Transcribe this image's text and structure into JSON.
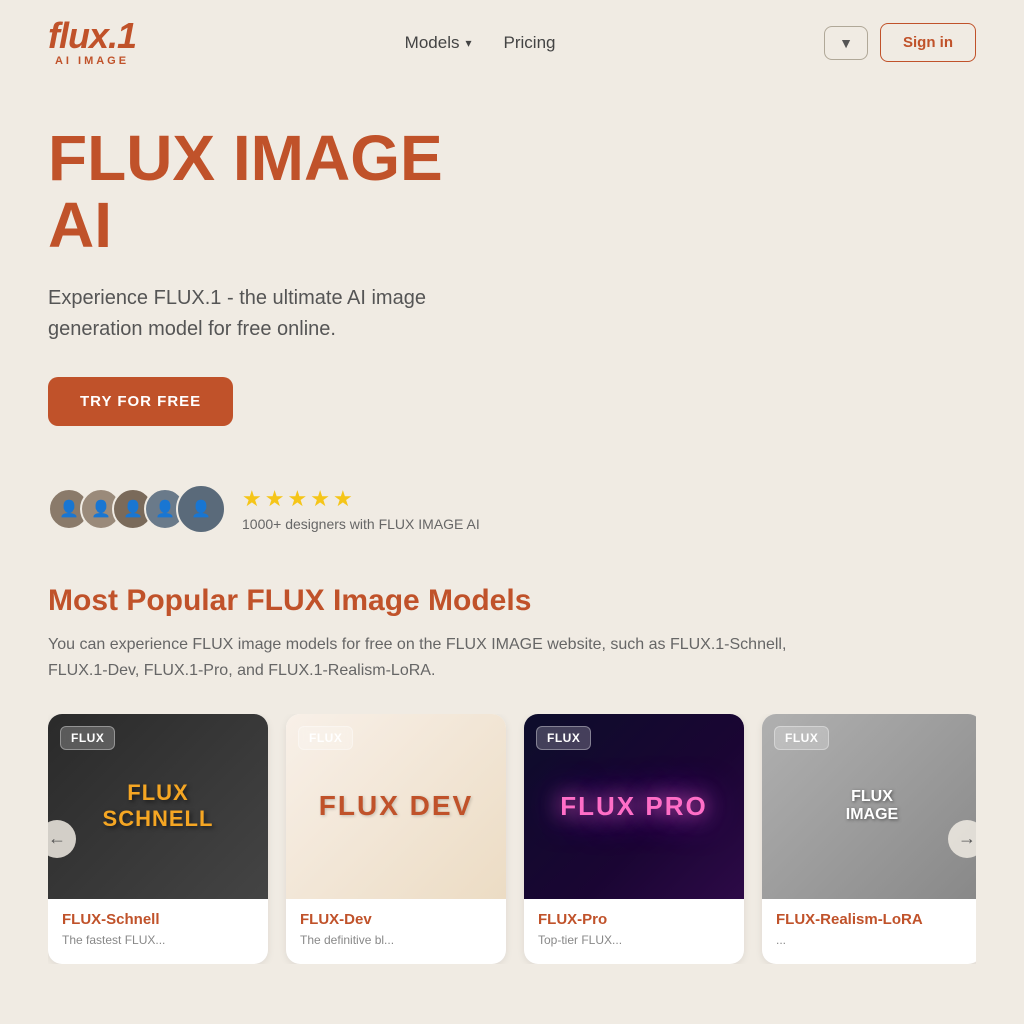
{
  "header": {
    "logo_main": "flux.1",
    "logo_sub": "AI IMAGE",
    "nav_models": "Models",
    "nav_pricing": "Pricing",
    "lang_btn_icon": "▼",
    "sign_in_label": "Sign in"
  },
  "hero": {
    "title_line1": "FLUX IMAGE",
    "title_line2": "AI",
    "description": "Experience FLUX.1 - the ultimate AI image generation model for free online.",
    "cta_label": "TRY FOR FREE"
  },
  "social_proof": {
    "stars": [
      "★",
      "★",
      "★",
      "★",
      "★"
    ],
    "text": "1000+ designers with FLUX IMAGE AI"
  },
  "models_section": {
    "title": "Most Popular FLUX Image Models",
    "description": "You can experience FLUX image models for free on the FLUX IMAGE website, such as FLUX.1-Schnell, FLUX.1-Dev, FLUX.1-Pro, and FLUX.1-Realism-LoRA.",
    "prev_label": "←",
    "next_label": "→"
  },
  "cards": [
    {
      "badge": "FLUX",
      "img_label_1": "FLUX",
      "img_label_2": "SCHNELL",
      "title": "FLUX-Schnell",
      "subtitle": "The fastest FLUX...",
      "style": "schnell"
    },
    {
      "badge": "FLUX",
      "img_label_1": "FLUX",
      "img_label_2": "DEV",
      "title": "FLUX-Dev",
      "subtitle": "The definitive bl...",
      "style": "dev"
    },
    {
      "badge": "FLUX",
      "img_label_1": "FLUX",
      "img_label_2": "PRO",
      "title": "FLUX-Pro",
      "subtitle": "Top-tier FLUX...",
      "style": "pro"
    },
    {
      "badge": "FLUX",
      "img_label_1": "FLUX",
      "img_label_2": "IMAGE",
      "title": "FLUX-Realism-LoRA",
      "subtitle": "...",
      "style": "realism"
    }
  ]
}
